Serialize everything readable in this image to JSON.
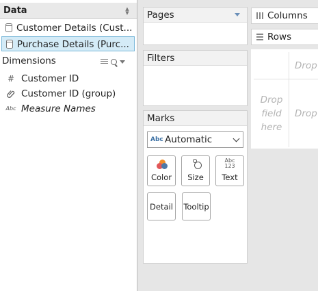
{
  "data_pane": {
    "title": "Data",
    "data_sources": [
      {
        "label": "Customer Details (Cust...",
        "selected": false
      },
      {
        "label": "Purchase Details (Purc...",
        "selected": true
      }
    ],
    "dimensions_title": "Dimensions",
    "fields": [
      {
        "icon": "#",
        "label": "Customer ID"
      },
      {
        "icon": "paperclip",
        "label": "Customer ID (group)"
      },
      {
        "icon": "Abc",
        "label": "Measure Names"
      }
    ]
  },
  "cards": {
    "pages": "Pages",
    "filters": "Filters",
    "marks": {
      "title": "Marks",
      "mark_type": "Automatic",
      "mark_type_icon": "Abc",
      "buttons": [
        "Color",
        "Size",
        "Text",
        "Detail",
        "Tooltip"
      ],
      "text_icon_lines": [
        "Abc",
        "123"
      ]
    }
  },
  "shelves": {
    "columns": "Columns",
    "rows": "Rows"
  },
  "canvas": {
    "drop_top": "Drop",
    "drop_field_lines": [
      "Drop",
      "field",
      "here"
    ],
    "drop_right": "Drop"
  }
}
